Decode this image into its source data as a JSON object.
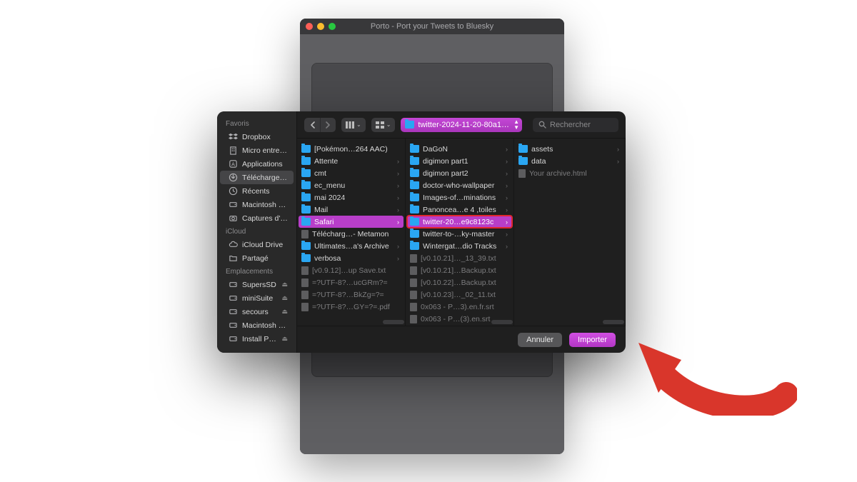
{
  "app": {
    "title": "Porto - Port your Tweets to Bluesky"
  },
  "dialog": {
    "toolbar": {
      "path_label": "twitter-2024-11-20-80a1…",
      "search_placeholder": "Rechercher"
    },
    "sidebar": {
      "sections": [
        {
          "title": "Favoris",
          "items": [
            {
              "icon": "dropbox",
              "label": "Dropbox"
            },
            {
              "icon": "building",
              "label": "Micro entre…"
            },
            {
              "icon": "app",
              "label": "Applications"
            },
            {
              "icon": "download",
              "label": "Télécharge…",
              "selected": true
            },
            {
              "icon": "clock",
              "label": "Récents"
            },
            {
              "icon": "hdd",
              "label": "Macintosh HD"
            },
            {
              "icon": "camera",
              "label": "Captures d'…"
            }
          ]
        },
        {
          "title": "iCloud",
          "items": [
            {
              "icon": "cloud",
              "label": "iCloud Drive"
            },
            {
              "icon": "folder",
              "label": "Partagé"
            }
          ]
        },
        {
          "title": "Emplacements",
          "items": [
            {
              "icon": "disk",
              "label": "SupersSD",
              "eject": true
            },
            {
              "icon": "disk",
              "label": "miniSuite",
              "eject": true
            },
            {
              "icon": "disk",
              "label": "secours",
              "eject": true
            },
            {
              "icon": "disk",
              "label": "Macintosh HD"
            },
            {
              "icon": "disk",
              "label": "Install P…",
              "eject": true
            }
          ]
        }
      ]
    },
    "columns": [
      {
        "items": [
          {
            "type": "folder",
            "name": "[Pokémon…264 AAC)"
          },
          {
            "type": "folder",
            "name": "Attente",
            "chevron": true
          },
          {
            "type": "folder",
            "name": "cmt",
            "chevron": true
          },
          {
            "type": "folder",
            "name": "ec_menu",
            "chevron": true
          },
          {
            "type": "folder",
            "name": "mai 2024",
            "chevron": true
          },
          {
            "type": "folder",
            "name": "Mail",
            "chevron": true
          },
          {
            "type": "folder",
            "name": "Safari",
            "chevron": true,
            "selected": true
          },
          {
            "type": "doc",
            "name": "Télécharg…- Metamon"
          },
          {
            "type": "folder",
            "name": "Ultimates…a's Archive",
            "chevron": true
          },
          {
            "type": "folder",
            "name": "verbosa",
            "chevron": true
          },
          {
            "type": "doc",
            "name": "[v0.9.12]…up Save.txt",
            "dim": true
          },
          {
            "type": "doc",
            "name": "=?UTF-8?…ucGRm?=",
            "dim": true
          },
          {
            "type": "doc",
            "name": "=?UTF-8?…BkZg=?=",
            "dim": true
          },
          {
            "type": "doc",
            "name": "=?UTF-8?…GY=?=.pdf",
            "dim": true
          }
        ]
      },
      {
        "items": [
          {
            "type": "folder",
            "name": "DaGoN",
            "chevron": true
          },
          {
            "type": "folder",
            "name": "digimon part1",
            "chevron": true
          },
          {
            "type": "folder",
            "name": "digimon part2",
            "chevron": true
          },
          {
            "type": "folder",
            "name": "doctor-who-wallpaper",
            "chevron": true
          },
          {
            "type": "folder",
            "name": "Images-of…minations",
            "chevron": true
          },
          {
            "type": "folder",
            "name": "Panoncea…e 4 ,toiles",
            "chevron": true
          },
          {
            "type": "folder",
            "name": "twitter-20…e9c8123c",
            "chevron": true,
            "highlighted": true
          },
          {
            "type": "folder",
            "name": "twitter-to-…ky-master",
            "chevron": true
          },
          {
            "type": "folder",
            "name": "Wintergat…dio Tracks",
            "chevron": true
          },
          {
            "type": "doc",
            "name": "[v0.10.21]…_13_39.txt",
            "dim": true
          },
          {
            "type": "doc",
            "name": "[v0.10.21]…Backup.txt",
            "dim": true
          },
          {
            "type": "doc",
            "name": "[v0.10.22]…Backup.txt",
            "dim": true
          },
          {
            "type": "doc",
            "name": "[v0.10.23]…_02_11.txt",
            "dim": true
          },
          {
            "type": "doc",
            "name": "0x063 - P…3).en.fr.srt",
            "dim": true
          },
          {
            "type": "doc",
            "name": "0x063 - P…(3).en.srt",
            "dim": true
          }
        ]
      },
      {
        "items": [
          {
            "type": "folder",
            "name": "assets",
            "chevron": true
          },
          {
            "type": "folder",
            "name": "data",
            "chevron": true
          },
          {
            "type": "doc",
            "name": "Your archive.html",
            "dim": true
          }
        ]
      }
    ],
    "footer": {
      "cancel": "Annuler",
      "confirm": "Importer"
    }
  }
}
